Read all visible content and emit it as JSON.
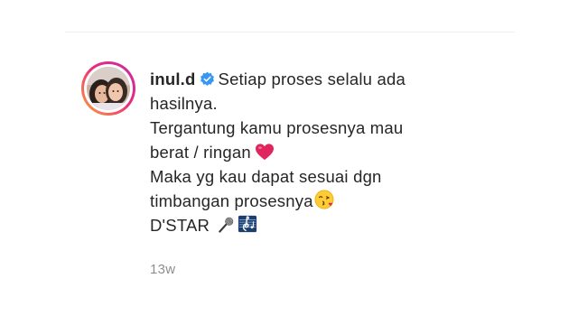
{
  "comment": {
    "username": "inul.d",
    "lines": [
      "Setiap proses selalu ada",
      "hasilnya.",
      "Tergantung kamu prosesnya mau",
      "berat / ringan",
      "Maka yg kau dapat sesuai dgn",
      "timbangan prosesnya",
      "D'STAR"
    ],
    "emojis": [
      "red-heart",
      "face-blowing-kiss",
      "microphone",
      "musical-score"
    ],
    "timestamp": "13w"
  },
  "colors": {
    "verified_badge": "#3897f0",
    "heart": "#e0245e",
    "muted_text": "#8e8e8e",
    "primary_text": "#262626"
  }
}
